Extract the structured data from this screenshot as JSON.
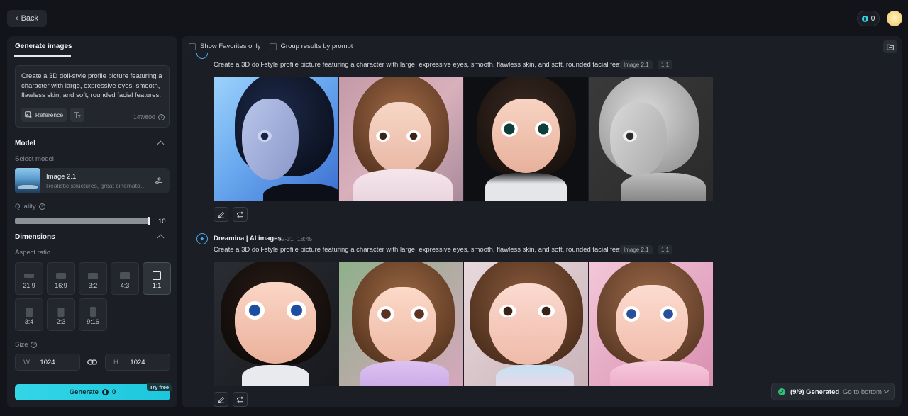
{
  "topbar": {
    "back_label": "Back",
    "credits": "0"
  },
  "left": {
    "tab": "Generate images",
    "prompt": "Create a 3D doll-style profile picture featuring a character with large, expressive eyes, smooth, flawless skin, and soft, rounded facial features.",
    "reference_label": "Reference",
    "char_count": "147/800",
    "model_section": "Model",
    "select_model_label": "Select model",
    "model_name": "Image 2.1",
    "model_desc": "Realistic structures, great cinematography",
    "quality_label": "Quality",
    "quality_value": "10",
    "quality_fraction": 1.0,
    "dimensions_section": "Dimensions",
    "aspect_label": "Aspect ratio",
    "ratios": [
      {
        "label": "21:9",
        "active": false
      },
      {
        "label": "16:9",
        "active": false
      },
      {
        "label": "3:2",
        "active": false
      },
      {
        "label": "4:3",
        "active": false
      },
      {
        "label": "1:1",
        "active": true
      },
      {
        "label": "3:4",
        "active": false
      },
      {
        "label": "2:3",
        "active": false
      },
      {
        "label": "9:16",
        "active": false
      }
    ],
    "size_label": "Size",
    "width_key": "W",
    "width_value": "1024",
    "height_key": "H",
    "height_value": "1024",
    "generate_label": "Generate",
    "generate_credits": "0",
    "try_free": "Try free"
  },
  "main": {
    "filter_favorites": "Show Favorites only",
    "filter_group": "Group results by prompt",
    "groups": [
      {
        "prompt": "Create a 3D doll-style profile picture featuring a character with large, expressive eyes, smooth, flawless skin, and soft, rounded facial features.",
        "chip_model": "Image 2.1",
        "chip_ratio": "1:1"
      },
      {
        "agent": "Dreamina | AI images",
        "date": "12-31",
        "time": "18:45",
        "prompt": "Create a 3D doll-style profile picture featuring a character with large, expressive eyes, smooth, flawless skin, and soft, rounded facial features.",
        "chip_model": "Image 2.1",
        "chip_ratio": "1:1"
      }
    ],
    "status": "(9/9) Generated",
    "goto_label": "Go to bottom"
  },
  "colors": {
    "accent": "#2fd5e6",
    "success": "#2fc07a",
    "agent_blue": "#4aa8f0"
  }
}
